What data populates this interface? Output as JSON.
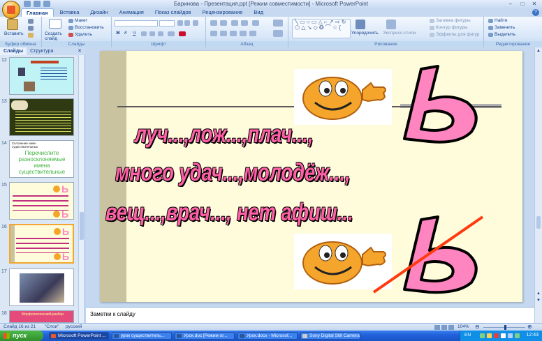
{
  "window": {
    "title": "Баринова - Презентация.ppt [Режим совместимости] - Microsoft PowerPoint"
  },
  "tabs": [
    "Главная",
    "Вставка",
    "Дизайн",
    "Анимация",
    "Показ слайдов",
    "Рецензирование",
    "Вид"
  ],
  "ribbon": {
    "clipboard": {
      "paste": "Вставить",
      "label": "Буфер обмена"
    },
    "slides": {
      "create": "Создать слайд",
      "layout": "Макет",
      "reset": "Восстановить",
      "delete": "Удалить",
      "label": "Слайды"
    },
    "font": {
      "label": "Шрифт"
    },
    "paragraph": {
      "label": "Абзац"
    },
    "drawing": {
      "arrange": "Упорядочить",
      "quick_styles": "Экспресс-стили",
      "fill": "Заливка фигуры",
      "outline": "Контур фигуры",
      "effects": "Эффекты для фигур",
      "label": "Рисование"
    },
    "editing": {
      "find": "Найти",
      "replace": "Заменить",
      "select": "Выделить",
      "label": "Редактирование"
    }
  },
  "left_panel": {
    "tabs": [
      "Слайды",
      "Структура"
    ],
    "slide_numbers": [
      "12",
      "13",
      "14",
      "15",
      "16",
      "17",
      "18"
    ],
    "slide14_title": "Склонение имен существительных",
    "slide14_body": "Перечислите разносклоняемые имена существительные",
    "slide18_title": "Морфологический разбор"
  },
  "slide": {
    "line1": "луч...,лож...,плач...,",
    "line2": "много удач...,молодёж...,",
    "line3": "вещ...,врач..., нет афиш..."
  },
  "notes": {
    "placeholder": "Заметки к слайду"
  },
  "status": {
    "slide_counter": "Слайд 16 из 21",
    "theme": "\"Слои\"",
    "language": "русский",
    "zoom": "104%"
  },
  "taskbar": {
    "start": "пуск",
    "tasks": [
      "Microsoft PowerPoint ...",
      "урок существитель...",
      "Урок.doc [Режим ог...",
      "Урок.docx - Microsof...",
      "Sony Digital Still Camera"
    ],
    "lang": "EN",
    "clock": "12:43"
  },
  "colors": {
    "ribbon_bg": "#d7e6f8",
    "slide_bg": "#fffcdb",
    "slide_text": "#ff5fa6",
    "soft_sign_pink": "#ff85c0",
    "taskbar": "#1f5fd8"
  }
}
